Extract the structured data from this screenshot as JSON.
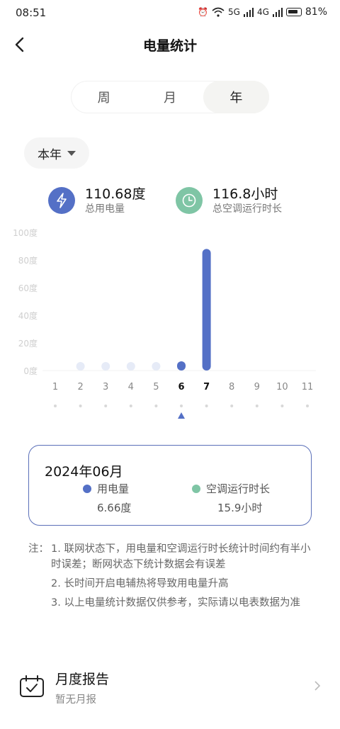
{
  "status": {
    "time": "08:51",
    "signal1": "5G",
    "signal2": "4G",
    "battery": "81%"
  },
  "header": {
    "title": "电量统计"
  },
  "tabs": [
    {
      "label": "周"
    },
    {
      "label": "月"
    },
    {
      "label": "年"
    }
  ],
  "active_tab": 2,
  "year_selector": {
    "label": "本年"
  },
  "summary": {
    "energy": {
      "value": "110.68度",
      "label": "总用电量"
    },
    "runtime": {
      "value": "116.8小时",
      "label": "总空调运行时长"
    }
  },
  "chart_data": {
    "type": "bar",
    "categories": [
      "1",
      "2",
      "3",
      "4",
      "5",
      "6",
      "7",
      "8",
      "9",
      "10",
      "11"
    ],
    "values": [
      0,
      2.5,
      1.5,
      3,
      2,
      6.66,
      88,
      0,
      0,
      0,
      0
    ],
    "highlight": [
      5,
      6
    ],
    "selected_index": 5,
    "ytick_labels": [
      "100度",
      "80度",
      "60度",
      "40度",
      "20度",
      "0度"
    ],
    "yticks": [
      100,
      80,
      60,
      40,
      20,
      0
    ],
    "ylim": [
      0,
      100
    ],
    "grid": false,
    "colors": {
      "active": "#5470c6",
      "inactive": "#e6ebf7",
      "label_dim": "#cfcfcf"
    }
  },
  "detail": {
    "date": "2024年06月",
    "energy": {
      "label": "用电量",
      "value": "6.66度",
      "color": "#5470c6"
    },
    "runtime": {
      "label": "空调运行时长",
      "value": "15.9小时",
      "color": "#7fc5a5"
    }
  },
  "notes": {
    "prefix": "注：",
    "items": [
      "1. 联网状态下，用电量和空调运行时长统计时间约有半小时误差；断网状态下统计数据会有误差",
      "2. 长时间开启电辅热将导致用电量升高",
      "3. 以上电量统计数据仅供参考，实际请以电表数据为准"
    ]
  },
  "report": {
    "title": "月度报告",
    "subtitle": "暂无月报"
  },
  "icons": {
    "energy": "lightning-icon",
    "runtime": "clock-icon",
    "report": "calendar-check-icon"
  },
  "colors": {
    "energy_circle": "#5470c6",
    "runtime_circle": "#7fc5a5",
    "card_border": "#5a6fb8"
  }
}
